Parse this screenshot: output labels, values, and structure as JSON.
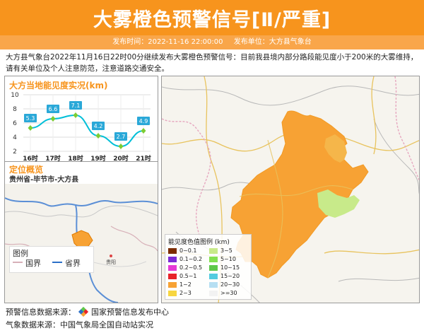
{
  "header": {
    "title": "大雾橙色预警信号[Ⅱ/严重]",
    "publish_time_label": "发布时间：2022-11-16 22:00:00",
    "publish_unit_label": "发布单位：大方县气象台"
  },
  "description": "大方县气象台2022年11月16日22时00分继续发布大雾橙色预警信号：目前我县境内部分路段能见度小于200米的大雾维持，请有关单位及个人注意防范，注意道路交通安全。",
  "visibility": {
    "section_title": "大方当地能见度实况(km)",
    "chart_data": {
      "type": "line",
      "categories": [
        "16时",
        "17时",
        "18时",
        "19时",
        "20时",
        "21时"
      ],
      "values": [
        5.3,
        6.6,
        7.1,
        4.2,
        2.7,
        4.9
      ],
      "value_labels": [
        "5.3",
        "6.6",
        "7.1",
        "4.2",
        "2.7",
        "4.9"
      ],
      "yticks": [
        "2",
        "4",
        "6",
        "8",
        "10"
      ],
      "ylim": [
        2,
        10
      ],
      "line_color": "#00bfd8",
      "marker_color": "#7dcc33",
      "label_bg": "#2aa8d8"
    }
  },
  "location": {
    "section_title": "定位概览",
    "path": "贵州省-毕节市-大方县",
    "legend_title": "图例",
    "legend_national": "国界",
    "legend_province": "省界",
    "city_label": "贵阳"
  },
  "map_legend": {
    "title": "能见度色值图例 (km)",
    "items": [
      {
        "label": "0~0.1",
        "color": "#7b2c00"
      },
      {
        "label": "3~5",
        "color": "#c8ea8a"
      },
      {
        "label": "0.1~0.2",
        "color": "#7b2bd6"
      },
      {
        "label": "5~10",
        "color": "#83e050"
      },
      {
        "label": "0.2~0.5",
        "color": "#e63ad6"
      },
      {
        "label": "10~15",
        "color": "#5ec84a"
      },
      {
        "label": "0.5~1",
        "color": "#e8232a"
      },
      {
        "label": "15~20",
        "color": "#53cbe0"
      },
      {
        "label": "1~2",
        "color": "#f7a234"
      },
      {
        "label": "20~30",
        "color": "#b6dff2"
      },
      {
        "label": "2~3",
        "color": "#f7d640"
      },
      {
        "label": ">=30",
        "color": "#f2f2f2"
      }
    ]
  },
  "footer": {
    "warning_source": "预警信息数据来源：",
    "warning_source_name": "国家预警信息发布中心",
    "weather_source": "气象数据来源：中国气象局全国自动站实况"
  }
}
